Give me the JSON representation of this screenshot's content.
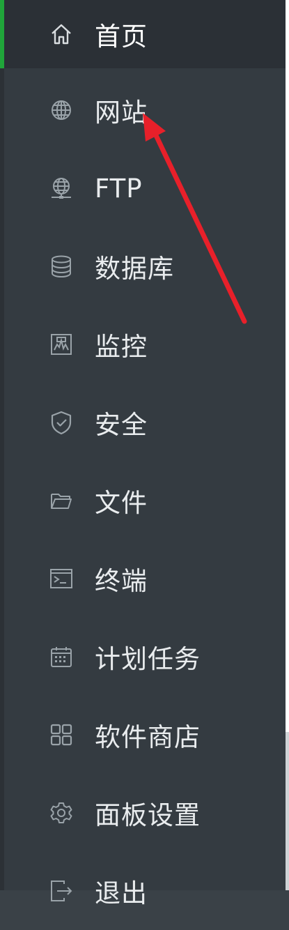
{
  "sidebar": {
    "items": [
      {
        "label": "首页",
        "icon": "home-icon",
        "active": true
      },
      {
        "label": "网站",
        "icon": "globe-icon"
      },
      {
        "label": "FTP",
        "icon": "ftp-icon"
      },
      {
        "label": "数据库",
        "icon": "database-icon"
      },
      {
        "label": "监控",
        "icon": "monitor-icon"
      },
      {
        "label": "安全",
        "icon": "shield-icon"
      },
      {
        "label": "文件",
        "icon": "folder-icon"
      },
      {
        "label": "终端",
        "icon": "terminal-icon"
      },
      {
        "label": "计划任务",
        "icon": "calendar-icon"
      },
      {
        "label": "软件商店",
        "icon": "grid-icon"
      },
      {
        "label": "面板设置",
        "icon": "gear-icon"
      },
      {
        "label": "退出",
        "icon": "logout-icon"
      }
    ]
  },
  "colors": {
    "sidebar_bg": "#343b41",
    "active_bg": "#2b3036",
    "accent": "#20a53a",
    "icon": "#9aa3a9",
    "label": "#e9ecee",
    "annotation_arrow": "#e8202a"
  }
}
